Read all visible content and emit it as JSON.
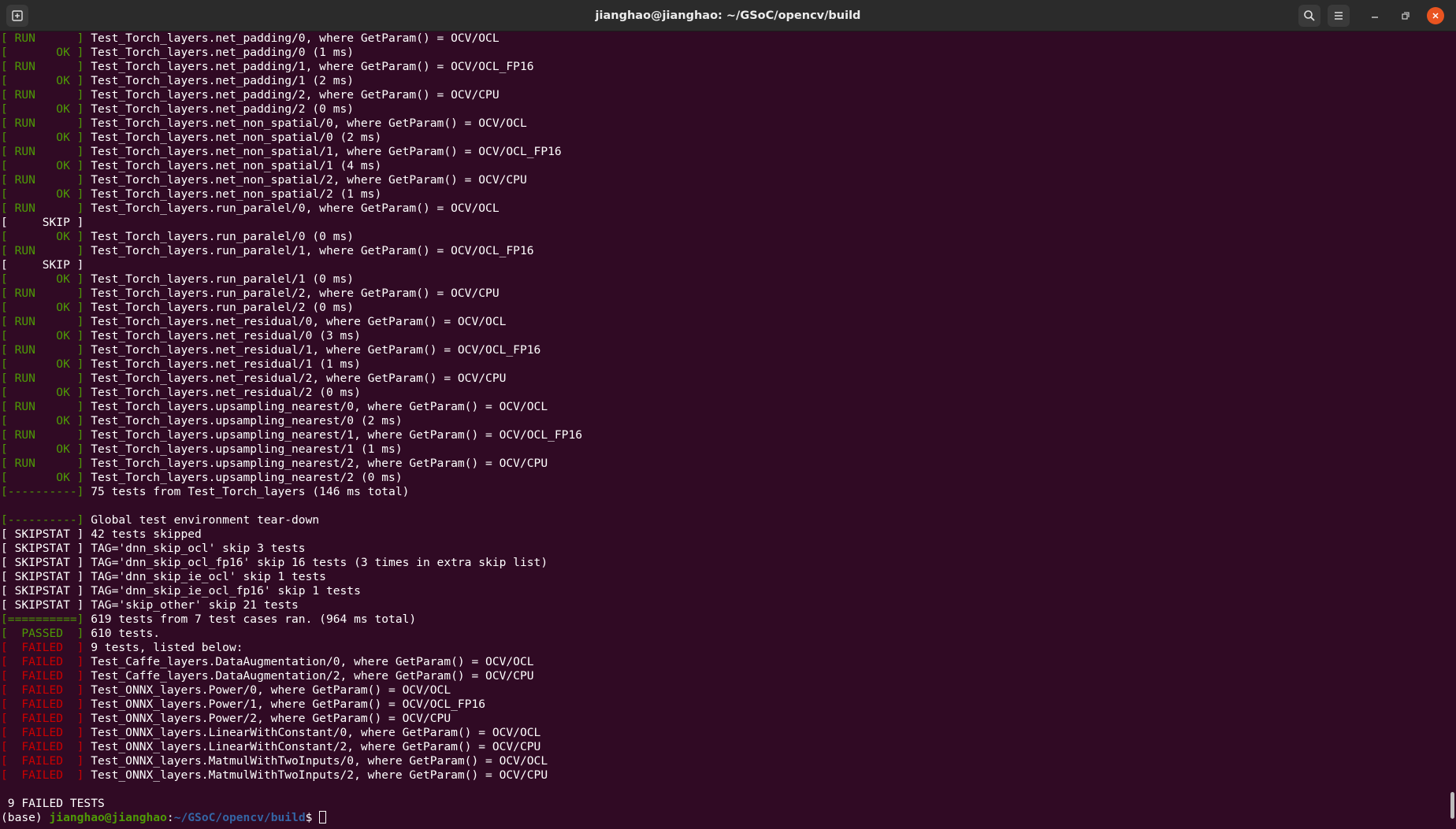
{
  "window": {
    "title": "jianghao@jianghao: ~/GSoC/opencv/build",
    "icons": {
      "new_tab": "new-tab-icon",
      "search": "search-icon",
      "menu": "hamburger-menu-icon",
      "minimize": "minimize-icon",
      "maximize": "maximize-icon",
      "close": "close-icon"
    }
  },
  "colors": {
    "background": "#300a24",
    "ok": "#4e9a06",
    "failed": "#cc0000",
    "text": "#ffffff",
    "path": "#3465a4",
    "close": "#e95420"
  },
  "lines": [
    {
      "tag": "[ RUN      ]",
      "c": "ok",
      "text": " Test_Torch_layers.net_padding/0, where GetParam() = OCV/OCL"
    },
    {
      "tag": "[       OK ]",
      "c": "ok",
      "text": " Test_Torch_layers.net_padding/0 (1 ms)"
    },
    {
      "tag": "[ RUN      ]",
      "c": "ok",
      "text": " Test_Torch_layers.net_padding/1, where GetParam() = OCV/OCL_FP16"
    },
    {
      "tag": "[       OK ]",
      "c": "ok",
      "text": " Test_Torch_layers.net_padding/1 (2 ms)"
    },
    {
      "tag": "[ RUN      ]",
      "c": "ok",
      "text": " Test_Torch_layers.net_padding/2, where GetParam() = OCV/CPU"
    },
    {
      "tag": "[       OK ]",
      "c": "ok",
      "text": " Test_Torch_layers.net_padding/2 (0 ms)"
    },
    {
      "tag": "[ RUN      ]",
      "c": "ok",
      "text": " Test_Torch_layers.net_non_spatial/0, where GetParam() = OCV/OCL"
    },
    {
      "tag": "[       OK ]",
      "c": "ok",
      "text": " Test_Torch_layers.net_non_spatial/0 (2 ms)"
    },
    {
      "tag": "[ RUN      ]",
      "c": "ok",
      "text": " Test_Torch_layers.net_non_spatial/1, where GetParam() = OCV/OCL_FP16"
    },
    {
      "tag": "[       OK ]",
      "c": "ok",
      "text": " Test_Torch_layers.net_non_spatial/1 (4 ms)"
    },
    {
      "tag": "[ RUN      ]",
      "c": "ok",
      "text": " Test_Torch_layers.net_non_spatial/2, where GetParam() = OCV/CPU"
    },
    {
      "tag": "[       OK ]",
      "c": "ok",
      "text": " Test_Torch_layers.net_non_spatial/2 (1 ms)"
    },
    {
      "tag": "[ RUN      ]",
      "c": "ok",
      "text": " Test_Torch_layers.run_paralel/0, where GetParam() = OCV/OCL"
    },
    {
      "tag": "[     SKIP ]",
      "c": "skip",
      "text": ""
    },
    {
      "tag": "[       OK ]",
      "c": "ok",
      "text": " Test_Torch_layers.run_paralel/0 (0 ms)"
    },
    {
      "tag": "[ RUN      ]",
      "c": "ok",
      "text": " Test_Torch_layers.run_paralel/1, where GetParam() = OCV/OCL_FP16"
    },
    {
      "tag": "[     SKIP ]",
      "c": "skip",
      "text": ""
    },
    {
      "tag": "[       OK ]",
      "c": "ok",
      "text": " Test_Torch_layers.run_paralel/1 (0 ms)"
    },
    {
      "tag": "[ RUN      ]",
      "c": "ok",
      "text": " Test_Torch_layers.run_paralel/2, where GetParam() = OCV/CPU"
    },
    {
      "tag": "[       OK ]",
      "c": "ok",
      "text": " Test_Torch_layers.run_paralel/2 (0 ms)"
    },
    {
      "tag": "[ RUN      ]",
      "c": "ok",
      "text": " Test_Torch_layers.net_residual/0, where GetParam() = OCV/OCL"
    },
    {
      "tag": "[       OK ]",
      "c": "ok",
      "text": " Test_Torch_layers.net_residual/0 (3 ms)"
    },
    {
      "tag": "[ RUN      ]",
      "c": "ok",
      "text": " Test_Torch_layers.net_residual/1, where GetParam() = OCV/OCL_FP16"
    },
    {
      "tag": "[       OK ]",
      "c": "ok",
      "text": " Test_Torch_layers.net_residual/1 (1 ms)"
    },
    {
      "tag": "[ RUN      ]",
      "c": "ok",
      "text": " Test_Torch_layers.net_residual/2, where GetParam() = OCV/CPU"
    },
    {
      "tag": "[       OK ]",
      "c": "ok",
      "text": " Test_Torch_layers.net_residual/2 (0 ms)"
    },
    {
      "tag": "[ RUN      ]",
      "c": "ok",
      "text": " Test_Torch_layers.upsampling_nearest/0, where GetParam() = OCV/OCL"
    },
    {
      "tag": "[       OK ]",
      "c": "ok",
      "text": " Test_Torch_layers.upsampling_nearest/0 (2 ms)"
    },
    {
      "tag": "[ RUN      ]",
      "c": "ok",
      "text": " Test_Torch_layers.upsampling_nearest/1, where GetParam() = OCV/OCL_FP16"
    },
    {
      "tag": "[       OK ]",
      "c": "ok",
      "text": " Test_Torch_layers.upsampling_nearest/1 (1 ms)"
    },
    {
      "tag": "[ RUN      ]",
      "c": "ok",
      "text": " Test_Torch_layers.upsampling_nearest/2, where GetParam() = OCV/CPU"
    },
    {
      "tag": "[       OK ]",
      "c": "ok",
      "text": " Test_Torch_layers.upsampling_nearest/2 (0 ms)"
    },
    {
      "tag": "[----------]",
      "c": "ok",
      "text": " 75 tests from Test_Torch_layers (146 ms total)"
    },
    {
      "tag": "",
      "c": "",
      "text": ""
    },
    {
      "tag": "[----------]",
      "c": "ok",
      "text": " Global test environment tear-down"
    },
    {
      "tag": "[ SKIPSTAT ]",
      "c": "skip",
      "text": " 42 tests skipped"
    },
    {
      "tag": "[ SKIPSTAT ]",
      "c": "skip",
      "text": " TAG='dnn_skip_ocl' skip 3 tests"
    },
    {
      "tag": "[ SKIPSTAT ]",
      "c": "skip",
      "text": " TAG='dnn_skip_ocl_fp16' skip 16 tests (3 times in extra skip list)"
    },
    {
      "tag": "[ SKIPSTAT ]",
      "c": "skip",
      "text": " TAG='dnn_skip_ie_ocl' skip 1 tests"
    },
    {
      "tag": "[ SKIPSTAT ]",
      "c": "skip",
      "text": " TAG='dnn_skip_ie_ocl_fp16' skip 1 tests"
    },
    {
      "tag": "[ SKIPSTAT ]",
      "c": "skip",
      "text": " TAG='skip_other' skip 21 tests"
    },
    {
      "tag": "[==========]",
      "c": "ok",
      "text": " 619 tests from 7 test cases ran. (964 ms total)"
    },
    {
      "tag": "[  PASSED  ]",
      "c": "ok",
      "text": " 610 tests."
    },
    {
      "tag": "[  FAILED  ]",
      "c": "fail",
      "text": " 9 tests, listed below:"
    },
    {
      "tag": "[  FAILED  ]",
      "c": "fail",
      "text": " Test_Caffe_layers.DataAugmentation/0, where GetParam() = OCV/OCL"
    },
    {
      "tag": "[  FAILED  ]",
      "c": "fail",
      "text": " Test_Caffe_layers.DataAugmentation/2, where GetParam() = OCV/CPU"
    },
    {
      "tag": "[  FAILED  ]",
      "c": "fail",
      "text": " Test_ONNX_layers.Power/0, where GetParam() = OCV/OCL"
    },
    {
      "tag": "[  FAILED  ]",
      "c": "fail",
      "text": " Test_ONNX_layers.Power/1, where GetParam() = OCV/OCL_FP16"
    },
    {
      "tag": "[  FAILED  ]",
      "c": "fail",
      "text": " Test_ONNX_layers.Power/2, where GetParam() = OCV/CPU"
    },
    {
      "tag": "[  FAILED  ]",
      "c": "fail",
      "text": " Test_ONNX_layers.LinearWithConstant/0, where GetParam() = OCV/OCL"
    },
    {
      "tag": "[  FAILED  ]",
      "c": "fail",
      "text": " Test_ONNX_layers.LinearWithConstant/2, where GetParam() = OCV/CPU"
    },
    {
      "tag": "[  FAILED  ]",
      "c": "fail",
      "text": " Test_ONNX_layers.MatmulWithTwoInputs/0, where GetParam() = OCV/OCL"
    },
    {
      "tag": "[  FAILED  ]",
      "c": "fail",
      "text": " Test_ONNX_layers.MatmulWithTwoInputs/2, where GetParam() = OCV/CPU"
    },
    {
      "tag": "",
      "c": "",
      "text": ""
    },
    {
      "tag": "",
      "c": "",
      "text": " 9 FAILED TESTS"
    }
  ],
  "prompt": {
    "env": "(base) ",
    "user": "jianghao@jianghao",
    "colon": ":",
    "path": "~/GSoC/opencv/build",
    "symbol": "$ "
  }
}
